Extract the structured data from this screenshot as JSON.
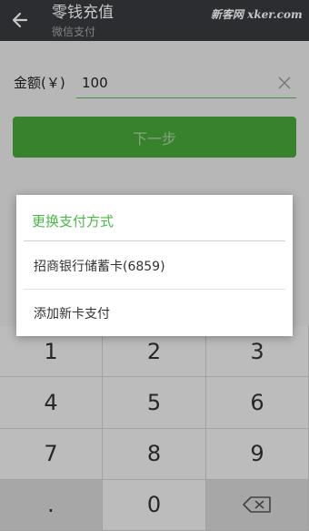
{
  "header": {
    "title": "零钱充值",
    "subtitle": "微信支付",
    "watermark": "新客网 xker.com"
  },
  "amount": {
    "label": "金额(￥)",
    "value": "100"
  },
  "next_button": {
    "label": "下一步"
  },
  "dialog": {
    "title": "更换支付方式",
    "options": [
      {
        "label": "招商银行储蓄卡(6859)"
      },
      {
        "label": "添加新卡支付"
      }
    ]
  },
  "keypad": {
    "keys": [
      "1",
      "2",
      "3",
      "4",
      "5",
      "6",
      "7",
      "8",
      "9",
      ".",
      "0",
      "backspace"
    ]
  },
  "colors": {
    "header_bg": "#393a3f",
    "accent_green": "#4aa73a",
    "dialog_title": "#4bb84a"
  }
}
